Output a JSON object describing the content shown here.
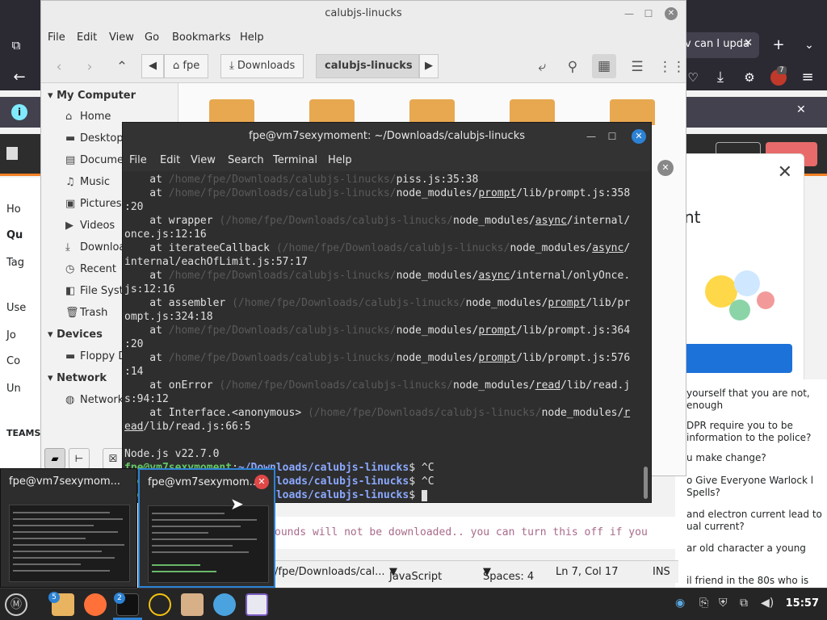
{
  "browser": {
    "tab_text": "v can I upda",
    "infobar_close": "✕",
    "left_nav": [
      "Ho",
      "Qu",
      "Tag",
      "Use",
      "Jo",
      "Co",
      "Un"
    ],
    "teams_label": "TEAMS",
    "modal_title": "nt",
    "modal_close": "✕",
    "badge_count": "7",
    "right_questions": [
      "yourself that you are not, enough",
      "DPR require you to be information to the police?",
      "u make change?",
      "o Give Everyone Warlock l Spells?",
      "and electron current lead to ual current?",
      "ar old character a young",
      "il friend in the 80s who is"
    ],
    "editor_line": "ounds will not be downloaded.. you can turn this off if you",
    "statusbar": {
      "path": "/fpe/Downloads/cal...",
      "language": "JavaScript",
      "spaces": "Spaces: 4",
      "position": "Ln 7, Col 17",
      "mode": "INS"
    }
  },
  "file_manager": {
    "title": "calubjs-linucks",
    "menu": [
      "File",
      "Edit",
      "View",
      "Go",
      "Bookmarks",
      "Help"
    ],
    "breadcrumbs": [
      "fpe",
      "Downloads",
      "calubjs-linucks"
    ],
    "sidebar": {
      "my_computer": "My Computer",
      "places": [
        "Home",
        "Desktop",
        "Documents",
        "Music",
        "Pictures",
        "Videos",
        "Downloads",
        "Recent",
        "File System",
        "Trash"
      ],
      "devices_heading": "Devices",
      "devices": [
        "Floppy D"
      ],
      "network_heading": "Network",
      "network": [
        "Network"
      ]
    }
  },
  "terminal": {
    "title": "fpe@vm7sexymoment: ~/Downloads/calubjs-linucks",
    "menu": [
      "File",
      "Edit",
      "View",
      "Search",
      "Terminal",
      "Help"
    ],
    "node_version": "Node.js v22.7.0",
    "prompt_user": "fpe@vm7sexymoment",
    "prompt_path": "~/Downloads/calubjs-linucks",
    "ctrl_c": "^C"
  },
  "alt_tab": {
    "items": [
      {
        "title": "fpe@vm7sexymom..."
      },
      {
        "title": "fpe@vm7sexymom..."
      }
    ]
  },
  "taskbar": {
    "badges": {
      "files": "5",
      "terminal": "2"
    },
    "clock": "15:57"
  }
}
